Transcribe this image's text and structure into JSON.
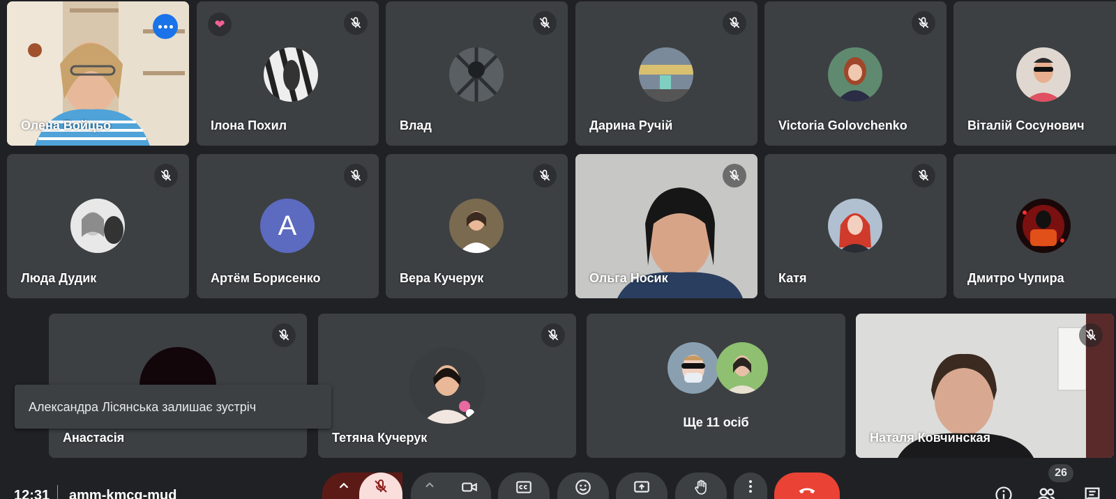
{
  "participants": [
    {
      "name": "Олена Войцьо"
    },
    {
      "name": "Ілона Похил"
    },
    {
      "name": "Влад"
    },
    {
      "name": "Дарина Ручій"
    },
    {
      "name": "Victoria Golovchenko"
    },
    {
      "name": "Віталій Сосунович"
    },
    {
      "name": "Люда Дудик"
    },
    {
      "name": "Артём Борисенко",
      "initial": "A"
    },
    {
      "name": "Вера Кучерук"
    },
    {
      "name": "Ольга Носик"
    },
    {
      "name": "Катя"
    },
    {
      "name": "Дмитро Чупира"
    },
    {
      "name": "Анастасія"
    },
    {
      "name": "Тетяна Кучерук"
    },
    {
      "name": "Наталя Ковчинская"
    }
  ],
  "others_tile": {
    "label": "Ще 11 осіб"
  },
  "toast": {
    "text": "Александра Лісянська залишає зустріч"
  },
  "meeting": {
    "time": "12:31",
    "code": "amm-kmcq-mud"
  },
  "people_count": "26",
  "colors": {
    "accent_blue": "#8ab4f8",
    "end_call_red": "#ea4335",
    "mic_off_red": "#f9dedc",
    "tile_bg": "#3c4043",
    "page_bg": "#202124"
  }
}
